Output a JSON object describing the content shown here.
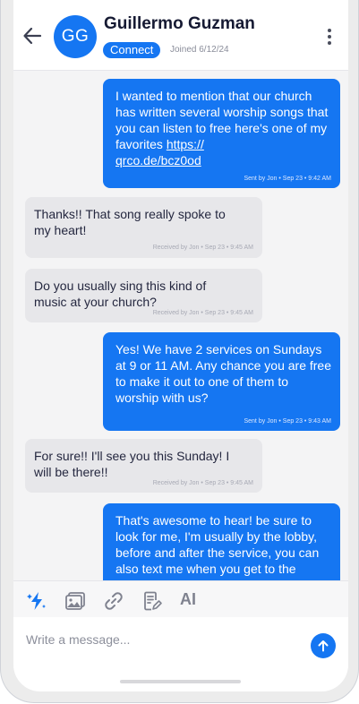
{
  "header": {
    "avatar_initials": "GG",
    "name": "Guillermo Guzman",
    "connect_label": "Connect",
    "joined": "Joined 6/12/24"
  },
  "messages": [
    {
      "dir": "sent",
      "text": "I wanted to mention that our church has written several worship songs that you can listen to free here's one of my favorites ",
      "link": "https://\nqrco.de/bcz0od",
      "meta": "Sent by Jon • Sep 23 • 9:42 AM"
    },
    {
      "dir": "recv",
      "text": "Thanks!! That song really spoke to\nmy heart!",
      "meta": "Received by Jon • Sep 23 • 9:45 AM"
    },
    {
      "dir": "recv",
      "text": "Do you usually sing this kind of\nmusic at your church?",
      "meta": "Received by Jon • Sep 23 • 9:45 AM"
    },
    {
      "dir": "sent",
      "text": "Yes! We have 2 services on Sundays at 9 or 11 AM. Any chance you are free to make it out to one of them to worship with us?",
      "meta": "Sent by Jon • Sep 23 • 9:43 AM"
    },
    {
      "dir": "recv",
      "text": "For sure!! I'll see you this Sunday! I\nwill be there!!",
      "meta": "Received by Jon • Sep 23 • 9:45 AM"
    },
    {
      "dir": "sent",
      "text": "That's awesome to hear! be sure to look for me, I'm usually by the lobby, before and after the service, you can also text me when you get to the church"
    }
  ],
  "toolbar": {
    "icons": [
      "lightning-icon",
      "image-icon",
      "link-icon",
      "template-icon"
    ],
    "ai_label": "AI"
  },
  "composer": {
    "placeholder": "Write a message..."
  },
  "colors": {
    "accent": "#1576f2",
    "received_bubble": "#e7e7ea",
    "background": "#f4f4f5"
  }
}
